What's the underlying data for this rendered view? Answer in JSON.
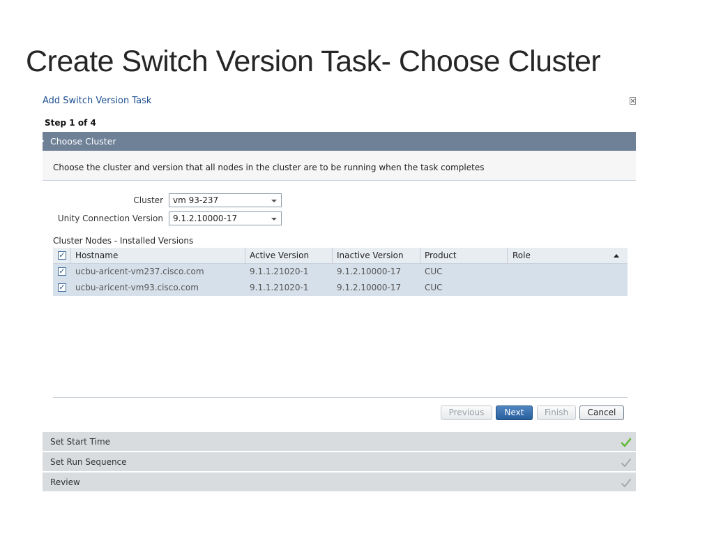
{
  "slide": {
    "title": "Create Switch Version Task- Choose Cluster"
  },
  "dialog": {
    "title": "Add Switch Version Task",
    "step": "Step 1 of 4",
    "close_icon": "close-icon"
  },
  "section": {
    "title": "Choose Cluster",
    "description": "Choose the cluster and version that all nodes in the cluster are to be running when the task completes"
  },
  "form": {
    "cluster_label": "Cluster",
    "cluster_value": "vm 93-237",
    "version_label": "Unity Connection Version",
    "version_value": "9.1.2.10000-17"
  },
  "table": {
    "caption": "Cluster Nodes - Installed Versions",
    "header_checked": true,
    "columns": [
      "Hostname",
      "Active Version",
      "Inactive Version",
      "Product",
      "Role"
    ],
    "rows": [
      {
        "checked": true,
        "hostname": "ucbu-aricent-vm237.cisco.com",
        "active": "9.1.1.21020-1",
        "inactive": "9.1.2.10000-17",
        "product": "CUC",
        "role": ""
      },
      {
        "checked": true,
        "hostname": "ucbu-aricent-vm93.cisco.com",
        "active": "9.1.1.21020-1",
        "inactive": "9.1.2.10000-17",
        "product": "CUC",
        "role": ""
      }
    ]
  },
  "buttons": {
    "previous": "Previous",
    "next": "Next",
    "finish": "Finish",
    "cancel": "Cancel"
  },
  "steps": [
    {
      "label": "Set Start Time",
      "status": "complete"
    },
    {
      "label": "Set Run Sequence",
      "status": "pending"
    },
    {
      "label": "Review",
      "status": "pending"
    }
  ],
  "colors": {
    "section_header": "#6f8197",
    "primary_button": "#275f9c",
    "check_complete": "#5fb832",
    "check_pending": "#a5a9ad"
  }
}
